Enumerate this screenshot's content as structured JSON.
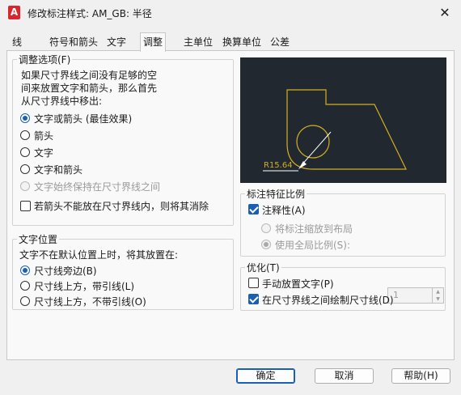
{
  "window": {
    "title": "修改标注样式: AM_GB: 半径",
    "app_icon_letter": "A"
  },
  "tabs": [
    "线",
    "符号和箭头",
    "文字",
    "调整",
    "主单位",
    "换算单位",
    "公差"
  ],
  "active_tab": "调整",
  "fit_options": {
    "title": "调整选项(F)",
    "description": [
      "如果尺寸界线之间没有足够的空",
      "间来放置文字和箭头，那么首先",
      "从尺寸界线中移出:"
    ],
    "radios": [
      {
        "label": "文字或箭头 (最佳效果)",
        "checked": true,
        "disabled": false
      },
      {
        "label": "箭头",
        "checked": false,
        "disabled": false
      },
      {
        "label": "文字",
        "checked": false,
        "disabled": false
      },
      {
        "label": "文字和箭头",
        "checked": false,
        "disabled": false
      },
      {
        "label": "文字始终保持在尺寸界线之间",
        "checked": false,
        "disabled": true
      }
    ],
    "suppress_arrows": {
      "label": "若箭头不能放在尺寸界线内，则将其消除",
      "checked": false
    }
  },
  "preview": {
    "dimension_label": "R15.64",
    "line_color": "#d4b020",
    "background": "#212830"
  },
  "text_placement": {
    "title": "文字位置",
    "description": "文字不在默认位置上时，将其放置在:",
    "radios": [
      {
        "label": "尺寸线旁边(B)",
        "checked": true
      },
      {
        "label": "尺寸线上方，带引线(L)",
        "checked": false
      },
      {
        "label": "尺寸线上方，不带引线(O)",
        "checked": false
      }
    ]
  },
  "scale": {
    "title": "标注特征比例",
    "annotative": {
      "label": "注释性(A)",
      "checked": true
    },
    "radios": [
      {
        "label": "将标注缩放到布局",
        "checked": false
      },
      {
        "label": "使用全局比例(S):",
        "checked": true
      }
    ],
    "global_scale_value": "1"
  },
  "fine_tuning": {
    "title": "优化(T)",
    "checks": [
      {
        "label": "手动放置文字(P)",
        "checked": false
      },
      {
        "label": "在尺寸界线之间绘制尺寸线(D)",
        "checked": true
      }
    ]
  },
  "buttons": {
    "ok": "确定",
    "cancel": "取消",
    "help": "帮助(H)"
  },
  "colors": {
    "accent": "#1a5fb4"
  }
}
